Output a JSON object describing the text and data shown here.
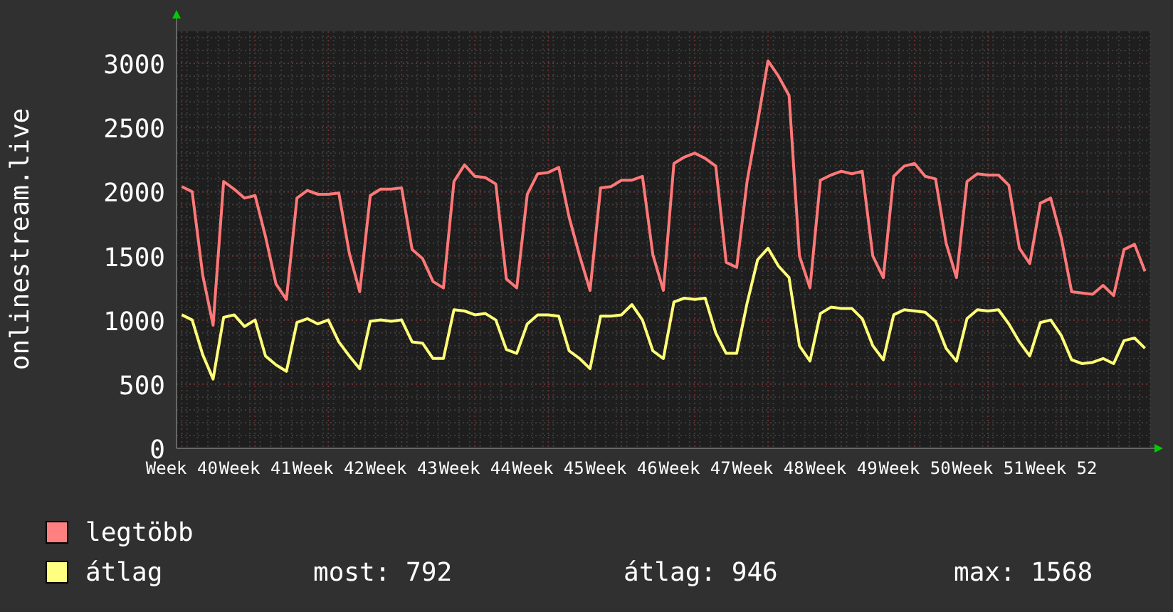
{
  "chart": {
    "chart_data": {
      "type": "line",
      "ylabel": "onlinestream.live",
      "grid": true,
      "categories": [
        "Week 40",
        null,
        null,
        null,
        null,
        null,
        null,
        "Week 41",
        null,
        null,
        null,
        null,
        null,
        null,
        "Week 42",
        null,
        null,
        null,
        null,
        null,
        null,
        "Week 43",
        null,
        null,
        null,
        null,
        null,
        null,
        "Week 44",
        null,
        null,
        null,
        null,
        null,
        null,
        "Week 45",
        null,
        null,
        null,
        null,
        null,
        null,
        "Week 46",
        null,
        null,
        null,
        null,
        null,
        null,
        "Week 47",
        null,
        null,
        null,
        null,
        null,
        null,
        "Week 48",
        null,
        null,
        null,
        null,
        null,
        null,
        "Week 49",
        null,
        null,
        null,
        null,
        null,
        null,
        "Week 50",
        null,
        null,
        null,
        null,
        null,
        null,
        "Week 51",
        null,
        null,
        null,
        null,
        null,
        null,
        "Week 52",
        null,
        null,
        null,
        null,
        null,
        null,
        null,
        null
      ],
      "ylim": [
        0,
        3250
      ],
      "yticks": [
        0,
        500,
        1000,
        1500,
        2000,
        2500,
        3000
      ],
      "series": [
        {
          "name": "legtöbb",
          "color": "#ff7878",
          "values": [
            2040,
            2000,
            1350,
            960,
            2080,
            2020,
            1950,
            1970,
            1650,
            1280,
            1160,
            1950,
            2010,
            1980,
            1980,
            1990,
            1520,
            1220,
            1970,
            2020,
            2020,
            2030,
            1550,
            1480,
            1300,
            1250,
            2080,
            2210,
            2120,
            2110,
            2060,
            1320,
            1250,
            1980,
            2140,
            2150,
            2190,
            1800,
            1500,
            1230,
            2030,
            2040,
            2090,
            2090,
            2120,
            1510,
            1230,
            2220,
            2270,
            2300,
            2260,
            2200,
            1450,
            1410,
            2080,
            2540,
            3020,
            2900,
            2750,
            1500,
            1250,
            2090,
            2130,
            2160,
            2140,
            2160,
            1500,
            1330,
            2120,
            2200,
            2220,
            2120,
            2100,
            1600,
            1330,
            2080,
            2140,
            2130,
            2130,
            2050,
            1560,
            1440,
            1910,
            1950,
            1640,
            1220,
            1210,
            1200,
            1270,
            1190,
            1550,
            1590,
            1380
          ]
        },
        {
          "name": "átlag",
          "color": "#ffff78",
          "values": [
            1040,
            1000,
            730,
            540,
            1020,
            1040,
            950,
            1000,
            720,
            650,
            600,
            980,
            1010,
            970,
            1000,
            830,
            720,
            620,
            990,
            1000,
            990,
            1000,
            830,
            820,
            700,
            700,
            1080,
            1070,
            1040,
            1050,
            1000,
            770,
            740,
            970,
            1040,
            1040,
            1030,
            760,
            700,
            620,
            1030,
            1030,
            1040,
            1120,
            1000,
            760,
            700,
            1140,
            1170,
            1160,
            1170,
            900,
            740,
            740,
            1130,
            1470,
            1560,
            1420,
            1330,
            800,
            680,
            1050,
            1100,
            1090,
            1090,
            1010,
            800,
            690,
            1040,
            1080,
            1070,
            1060,
            990,
            780,
            680,
            1010,
            1080,
            1070,
            1080,
            970,
            830,
            720,
            980,
            1000,
            880,
            690,
            660,
            670,
            700,
            660,
            840,
            860,
            780
          ]
        }
      ]
    }
  },
  "legend": [
    {
      "color": "#ff8080"
    },
    {
      "color": "#ffff80",
      "stats": [
        "most: 792",
        "átlag: 946",
        "max: 1568"
      ]
    }
  ]
}
